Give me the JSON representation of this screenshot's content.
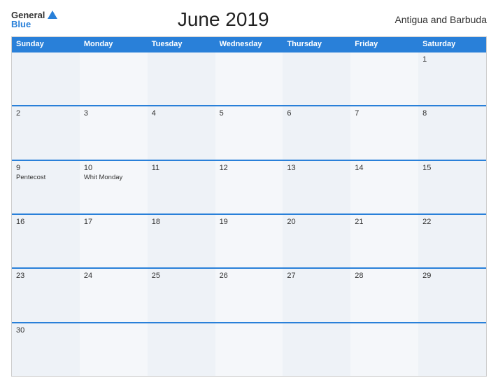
{
  "header": {
    "logo_general": "General",
    "logo_blue": "Blue",
    "title": "June 2019",
    "country": "Antigua and Barbuda"
  },
  "days_of_week": [
    "Sunday",
    "Monday",
    "Tuesday",
    "Wednesday",
    "Thursday",
    "Friday",
    "Saturday"
  ],
  "weeks": [
    [
      {
        "day": "",
        "col": 0
      },
      {
        "day": "",
        "col": 1
      },
      {
        "day": "",
        "col": 2
      },
      {
        "day": "",
        "col": 3
      },
      {
        "day": "",
        "col": 4
      },
      {
        "day": "",
        "col": 5
      },
      {
        "day": "1",
        "col": 6
      }
    ],
    [
      {
        "day": "2",
        "col": 0
      },
      {
        "day": "3",
        "col": 1
      },
      {
        "day": "4",
        "col": 2
      },
      {
        "day": "5",
        "col": 3
      },
      {
        "day": "6",
        "col": 4
      },
      {
        "day": "7",
        "col": 5
      },
      {
        "day": "8",
        "col": 6
      }
    ],
    [
      {
        "day": "9",
        "col": 0,
        "event": "Pentecost"
      },
      {
        "day": "10",
        "col": 1,
        "event": "Whit Monday"
      },
      {
        "day": "11",
        "col": 2
      },
      {
        "day": "12",
        "col": 3
      },
      {
        "day": "13",
        "col": 4
      },
      {
        "day": "14",
        "col": 5
      },
      {
        "day": "15",
        "col": 6
      }
    ],
    [
      {
        "day": "16",
        "col": 0
      },
      {
        "day": "17",
        "col": 1
      },
      {
        "day": "18",
        "col": 2
      },
      {
        "day": "19",
        "col": 3
      },
      {
        "day": "20",
        "col": 4
      },
      {
        "day": "21",
        "col": 5
      },
      {
        "day": "22",
        "col": 6
      }
    ],
    [
      {
        "day": "23",
        "col": 0
      },
      {
        "day": "24",
        "col": 1
      },
      {
        "day": "25",
        "col": 2
      },
      {
        "day": "26",
        "col": 3
      },
      {
        "day": "27",
        "col": 4
      },
      {
        "day": "28",
        "col": 5
      },
      {
        "day": "29",
        "col": 6
      }
    ],
    [
      {
        "day": "30",
        "col": 0
      },
      {
        "day": "",
        "col": 1
      },
      {
        "day": "",
        "col": 2
      },
      {
        "day": "",
        "col": 3
      },
      {
        "day": "",
        "col": 4
      },
      {
        "day": "",
        "col": 5
      },
      {
        "day": "",
        "col": 6
      }
    ]
  ]
}
